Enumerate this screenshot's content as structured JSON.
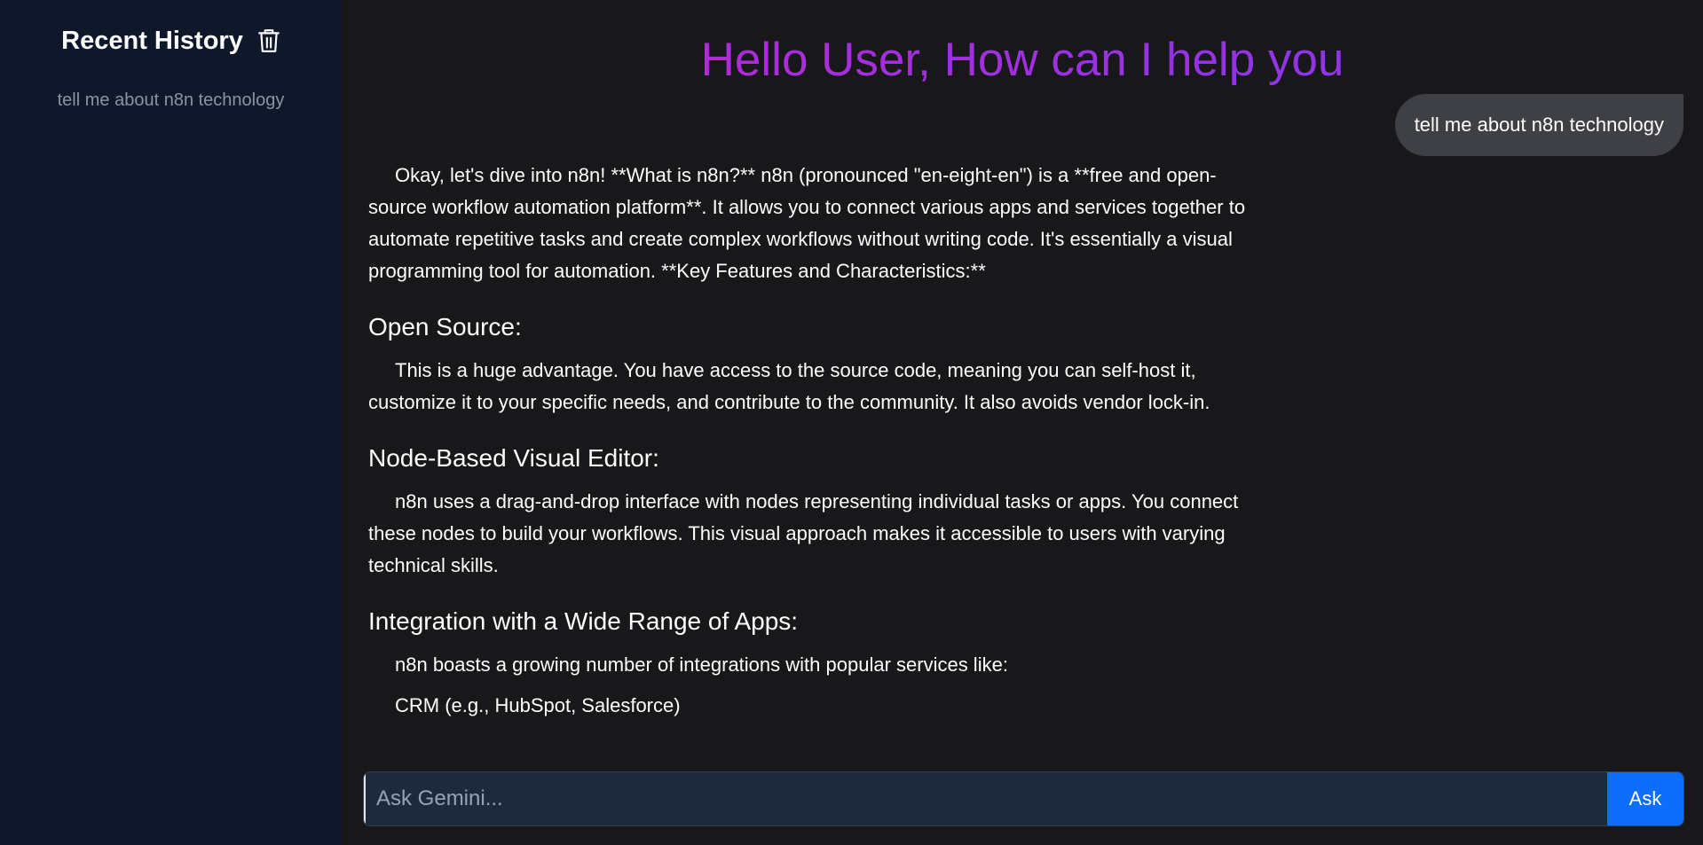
{
  "sidebar": {
    "title": "Recent History",
    "history": [
      "tell me about n8n technology"
    ]
  },
  "main": {
    "greeting": "Hello User, How can I help you",
    "user_message": "tell me about n8n technology",
    "answer": {
      "intro": "Okay, let's dive into n8n! **What is n8n?** n8n (pronounced \"en-eight-en\") is a **free and open-source workflow automation platform**. It allows you to connect various apps and services together to automate repetitive tasks and create complex workflows without writing code. It's essentially a visual programming tool for automation. **Key Features and Characteristics:**",
      "sections": [
        {
          "heading": "Open Source:",
          "paragraphs": [
            "This is a huge advantage. You have access to the source code, meaning you can self-host it, customize it to your specific needs, and contribute to the community. It also avoids vendor lock-in."
          ]
        },
        {
          "heading": "Node-Based Visual Editor:",
          "paragraphs": [
            "n8n uses a drag-and-drop interface with nodes representing individual tasks or apps. You connect these nodes to build your workflows. This visual approach makes it accessible to users with varying technical skills."
          ]
        },
        {
          "heading": "Integration with a Wide Range of Apps:",
          "paragraphs": [
            "n8n boasts a growing number of integrations with popular services like:",
            "CRM (e.g., HubSpot, Salesforce)"
          ]
        }
      ]
    }
  },
  "input": {
    "placeholder": "Ask Gemini...",
    "button_label": "Ask"
  },
  "colors": {
    "sidebar_bg": "#0f172a",
    "main_bg": "#18181b",
    "accent": "#0d6efd",
    "greeting_gradient": [
      "#c026d3",
      "#7c3aed"
    ]
  }
}
